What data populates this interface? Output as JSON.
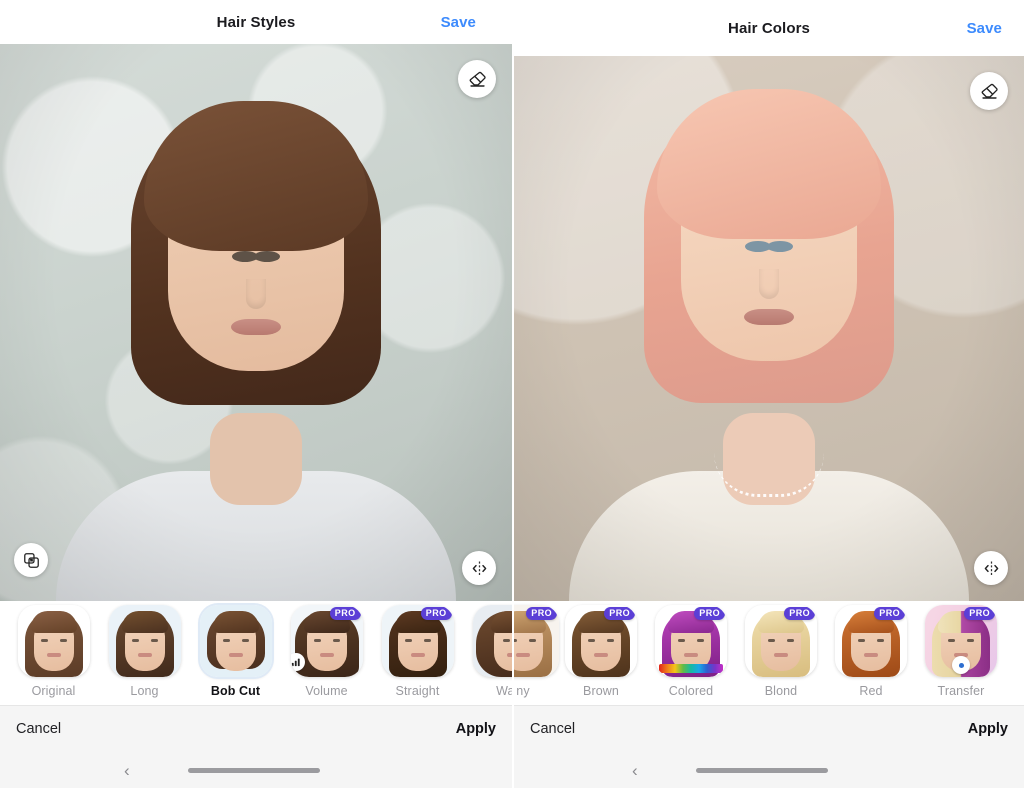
{
  "screens": [
    {
      "id": "hair-styles",
      "header": {
        "title": "Hair Styles",
        "save_label": "Save"
      },
      "overlay_buttons": {
        "eraser": "eraser-icon",
        "compare": "compare-layers-icon",
        "split": "before-after-split-icon"
      },
      "photo": {
        "description": "Woman with brown bob haircut on pale gray-green textured wallpaper",
        "background_color": "#c9d2cd",
        "hair_color": "#5c3a25"
      },
      "thumbnails": [
        {
          "label": "Original",
          "selected": false,
          "pro": false,
          "bg": "#ffffff",
          "hair": "#6d4a33",
          "mini_badge": null,
          "rainbow": false,
          "clipped": false
        },
        {
          "label": "Long",
          "selected": false,
          "pro": false,
          "bg": "#eaf2f8",
          "hair": "#4f3322",
          "mini_badge": null,
          "rainbow": false,
          "clipped": false
        },
        {
          "label": "Bob Cut",
          "selected": true,
          "pro": false,
          "bg": "#e4f0f7",
          "hair": "#5a3a27",
          "mini_badge": null,
          "rainbow": false,
          "clipped": false
        },
        {
          "label": "Volume",
          "selected": false,
          "pro": true,
          "bg": "#f2f6f9",
          "hair": "#4a2f1f",
          "mini_badge": "signal-bars-icon",
          "rainbow": false,
          "clipped": false
        },
        {
          "label": "Straight",
          "selected": false,
          "pro": true,
          "bg": "#eef4f8",
          "hair": "#3f281a",
          "mini_badge": null,
          "rainbow": false,
          "clipped": false
        },
        {
          "label": "Wav",
          "selected": false,
          "pro": false,
          "bg": "#e8edf2",
          "hair": "#5b3a25",
          "mini_badge": null,
          "rainbow": false,
          "clipped": true
        }
      ],
      "footer": {
        "cancel_label": "Cancel",
        "apply_label": "Apply"
      },
      "system_nav": {
        "back_icon": "chevron-left-icon",
        "home_indicator": "home-pill"
      }
    },
    {
      "id": "hair-colors",
      "header": {
        "title": "Hair Colors",
        "save_label": "Save"
      },
      "overlay_buttons": {
        "eraser": "eraser-icon",
        "compare": null,
        "split": "before-after-split-icon"
      },
      "photo": {
        "description": "Woman with pink bob haircut and pearl necklace on warm beige background",
        "background_color": "#cfc3b4",
        "hair_color": "#eaa893"
      },
      "thumbnails": [
        {
          "label": "ny",
          "selected": false,
          "pro": true,
          "bg": "#f7f3ee",
          "hair": "#b98e62",
          "mini_badge": null,
          "rainbow": false,
          "clipped": true
        },
        {
          "label": "Brown",
          "selected": false,
          "pro": true,
          "bg": "#ffffff",
          "hair": "#6b4428",
          "mini_badge": null,
          "rainbow": false,
          "clipped": false
        },
        {
          "label": "Colored",
          "selected": false,
          "pro": true,
          "bg": "#ffffff",
          "hair": "#9c2f9c",
          "mini_badge": null,
          "rainbow": true,
          "clipped": false
        },
        {
          "label": "Blond",
          "selected": false,
          "pro": true,
          "bg": "#ffffff",
          "hair": "#e8d49a",
          "mini_badge": null,
          "rainbow": false,
          "clipped": false
        },
        {
          "label": "Red",
          "selected": false,
          "pro": true,
          "bg": "#ffffff",
          "hair": "#b55a22",
          "mini_badge": null,
          "rainbow": false,
          "clipped": false
        },
        {
          "label": "Transfer",
          "selected": false,
          "pro": true,
          "bg": "#f6d9e6",
          "hair": "#b04a9e",
          "mini_badge": "blue-dot-icon",
          "rainbow": false,
          "clipped": false
        }
      ],
      "footer": {
        "cancel_label": "Cancel",
        "apply_label": "Apply"
      },
      "system_nav": {
        "back_icon": "chevron-left-icon",
        "home_indicator": "home-pill"
      }
    }
  ],
  "badges": {
    "pro_label": "PRO",
    "pro_color": "#5b3fd6"
  },
  "accent_color": "#3d8bfd"
}
